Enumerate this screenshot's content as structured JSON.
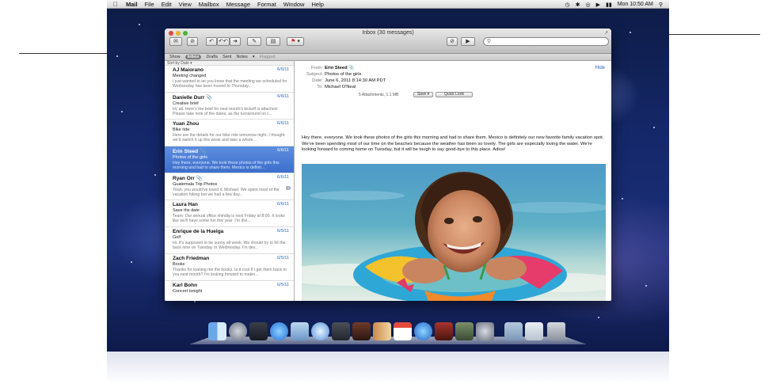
{
  "menubar": {
    "app_name": "Mail",
    "menus": [
      "File",
      "Edit",
      "View",
      "Mailbox",
      "Message",
      "Format",
      "Window",
      "Help"
    ],
    "clock": "Mon 10:50 AM"
  },
  "window": {
    "title": "Inbox (30 messages)",
    "search_placeholder": ""
  },
  "favorites": {
    "show": "Show",
    "inbox": "Inbox",
    "drafts": "Drafts",
    "sent": "Sent",
    "notes": "Notes",
    "flagged": "Flagged"
  },
  "list": {
    "sort_label": "Sort by Date",
    "messages": [
      {
        "from": "AJ Maiorano",
        "date": "6/6/11",
        "subject": "Meeting changed",
        "preview": "I just wanted to let you know that the meeting we scheduled for Wednesday has been moved to Thursday..."
      },
      {
        "from": "Danielle Durr",
        "date": "6/6/11",
        "subject": "Creative brief",
        "preview": "Hi, all. Here's the brief for next month's kickoff is attached. Please take note of the dates, as the turnaround on t..."
      },
      {
        "from": "Yuan Zhou",
        "date": "6/6/11",
        "subject": "Bike ride",
        "preview": "Here are the details for our bike ride tomorrow night. I thought we'd switch it up this week and take a whole..."
      },
      {
        "from": "Erin Steed",
        "date": "6/6/11",
        "subject": "Photos of the girls",
        "preview": "Hey there, everyone. We took these photos of the girls this morning and had to share them. Mexico is definit..."
      },
      {
        "from": "Ryan Orr",
        "date": "6/6/11",
        "subject": "Guatemala Trip Photos",
        "preview": "Yeah, you would've loved it, Michael. We spent most of the vacation hiking but we had a few day..."
      },
      {
        "from": "Laura Han",
        "date": "6/6/11",
        "subject": "Save the date",
        "preview": "Team: Our annual office shindig is next Friday at 8:00. It looks like we'll have some fun this year. I'm divi..."
      },
      {
        "from": "Enrique de la Huelga",
        "date": "6/5/11",
        "subject": "Golf",
        "preview": "Hi. It's supposed to be sunny all week. We should try to hit the back nine on Tuesday or Wednesday. I'm dev..."
      },
      {
        "from": "Zach Friedman",
        "date": "6/5/11",
        "subject": "Books",
        "preview": "Thanks for loaning me the books. Is it cool if I get them back to you next month? I'm looking forward to makin..."
      },
      {
        "from": "Karl Bohn",
        "date": "6/5/11",
        "subject": "Concert tonight",
        "preview": ""
      }
    ],
    "thread_badge": "2"
  },
  "reader": {
    "from_label": "From:",
    "from_value": "Erin Steed",
    "subject_label": "Subject:",
    "subject_value": "Photos of the girls",
    "date_label": "Date:",
    "date_value": "June 6, 2011 8:14:30 AM PDT",
    "to_label": "To:",
    "to_value": "Michael O'Neal",
    "hide": "Hide",
    "attachments": "5 Attachments, 1.1 MB",
    "save_button": "Save",
    "quicklook_button": "Quick Look",
    "body": "Hey there, everyone. We took these photos of the girls this morning and had to share them. Mexico is definitely our new favorite family vacation spot. We've been spending most of our time on the beaches because the weather has been so lovely. The girls are especially loving the water. We're looking forward to coming home on Tuesday, but it will be tough to say good-bye to this place. Adios!"
  },
  "colors": {
    "accent": "#2a62c8",
    "selection": "#3d6fcc"
  }
}
